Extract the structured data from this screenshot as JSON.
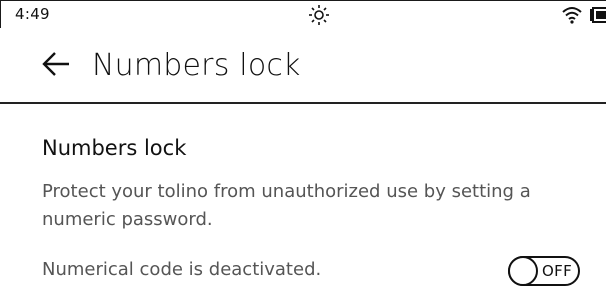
{
  "status_bar": {
    "time": "4:49",
    "icons": [
      "brightness-icon",
      "wifi-icon",
      "battery-icon"
    ]
  },
  "header": {
    "back_icon": "arrow-left-icon",
    "title": "Numbers lock"
  },
  "content": {
    "section_title": "Numbers lock",
    "description": "Protect your tolino from unauthorized use by setting a numeric password.",
    "status_text": "Numerical code is deactivated.",
    "toggle": {
      "label": "OFF",
      "state": "off"
    }
  }
}
